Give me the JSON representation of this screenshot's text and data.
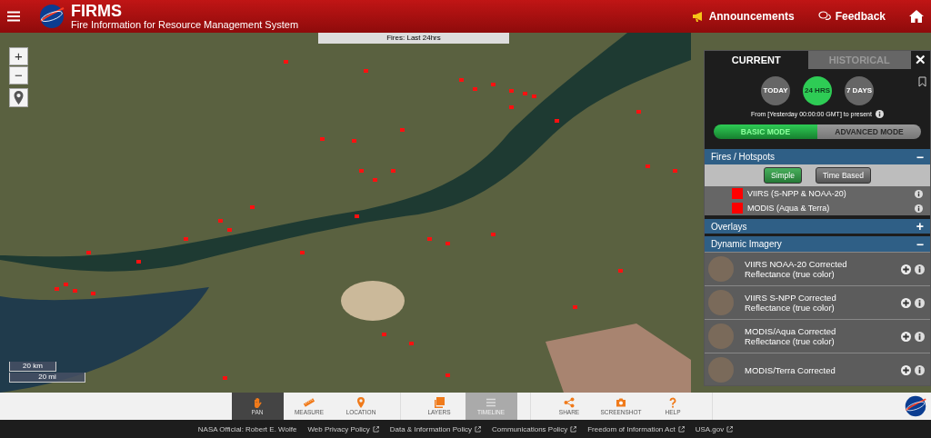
{
  "header": {
    "title": "FIRMS",
    "subtitle": "Fire Information for Resource Management System",
    "links": [
      {
        "label": "Announcements"
      },
      {
        "label": "Feedback"
      }
    ]
  },
  "map": {
    "label": "Fires: Last 24hrs",
    "zoom_in": "+",
    "zoom_out": "−",
    "scale": [
      "20 km",
      "20 mi"
    ]
  },
  "panel": {
    "tabs": [
      {
        "label": "CURRENT",
        "selected": true
      },
      {
        "label": "HISTORICAL",
        "selected": false
      }
    ],
    "close": "✕",
    "periods": [
      {
        "label": "TODAY",
        "selected": false
      },
      {
        "label": "24 HRS",
        "selected": true
      },
      {
        "label": "7 DAYS",
        "selected": false
      }
    ],
    "range_text": "From [Yesterday 00:00:00 GMT] to present",
    "modes": [
      {
        "label": "BASIC MODE",
        "selected": true
      },
      {
        "label": "ADVANCED MODE",
        "selected": false
      }
    ],
    "sections": [
      {
        "title": "Fires / Hotspots",
        "expanded": true,
        "kind": "fires",
        "toggle": "−",
        "styles": [
          {
            "label": "Simple",
            "selected": true
          },
          {
            "label": "Time Based",
            "selected": false
          }
        ],
        "layers": [
          {
            "label": "VIIRS (S-NPP & NOAA-20)",
            "color": "#ff0000"
          },
          {
            "label": "MODIS (Aqua & Terra)",
            "color": "#ff0000"
          }
        ]
      },
      {
        "title": "Overlays",
        "expanded": false,
        "kind": "overlays",
        "toggle": "+"
      },
      {
        "title": "Dynamic Imagery",
        "expanded": true,
        "kind": "imagery",
        "toggle": "−",
        "items": [
          {
            "label": "VIIRS NOAA-20 Corrected Reflectance (true color)"
          },
          {
            "label": "VIIRS S-NPP Corrected Reflectance (true color)"
          },
          {
            "label": "MODIS/Aqua Corrected Reflectance (true color)"
          },
          {
            "label": "MODIS/Terra Corrected"
          }
        ]
      }
    ]
  },
  "toolbar": [
    [
      {
        "label": "PAN",
        "selected": true,
        "disabled": false
      },
      {
        "label": "MEASURE",
        "selected": false,
        "disabled": false
      },
      {
        "label": "LOCATION",
        "selected": false,
        "disabled": false
      }
    ],
    [
      {
        "label": "LAYERS",
        "selected": false,
        "disabled": false
      },
      {
        "label": "TIMELINE",
        "selected": false,
        "disabled": true
      }
    ],
    [
      {
        "label": "SHARE",
        "selected": false,
        "disabled": false
      },
      {
        "label": "SCREENSHOT",
        "selected": false,
        "disabled": false
      },
      {
        "label": "HELP",
        "selected": false,
        "disabled": false
      }
    ]
  ],
  "footer": [
    {
      "label": "NASA Official: Robert E. Wolfe",
      "external": false
    },
    {
      "label": "Web Privacy Policy",
      "external": true
    },
    {
      "label": "Data & Information Policy",
      "external": true
    },
    {
      "label": "Communications Policy",
      "external": true
    },
    {
      "label": "Freedom of Information Act",
      "external": true
    },
    {
      "label": "USA.gov",
      "external": true
    }
  ]
}
